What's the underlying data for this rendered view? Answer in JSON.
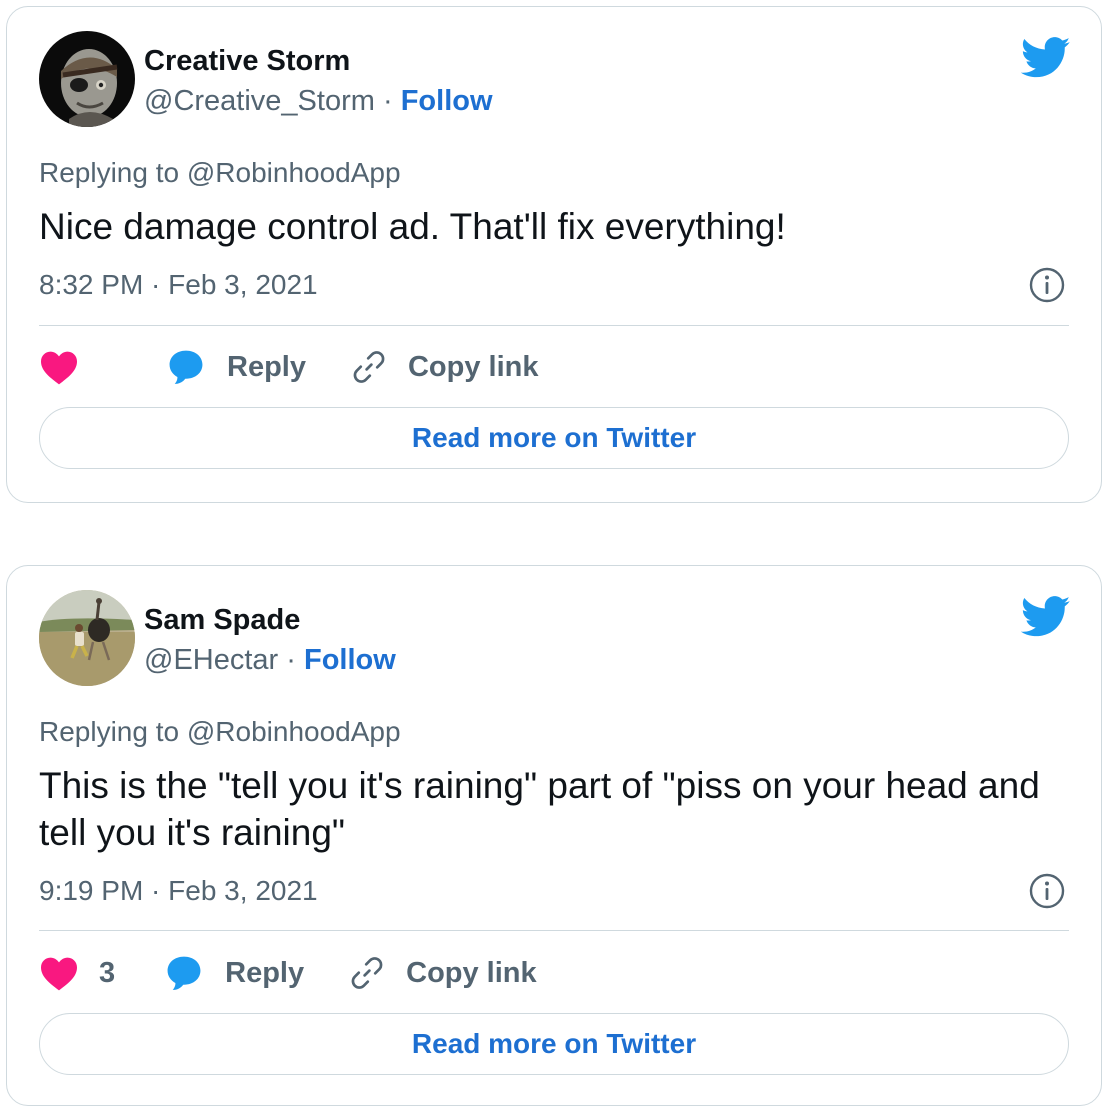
{
  "brand": {
    "twitter_blue": "#1d9bf0",
    "link_blue": "#1d6fd1",
    "like_pink": "#f91880"
  },
  "tweets": [
    {
      "author_name": "Creative Storm",
      "author_handle": "@Creative_Storm",
      "separator": "·",
      "follow_label": "Follow",
      "replying_to": "Replying to @RobinhoodApp",
      "text": "Nice damage control ad. That'll fix everything!",
      "timestamp": "8:32 PM · Feb 3, 2021",
      "like_count": "",
      "reply_label": "Reply",
      "copy_link_label": "Copy link",
      "read_more_label": "Read more on Twitter",
      "icons": {
        "avatar": "avatar-eyepatch-man",
        "logo": "twitter-bird-icon",
        "info": "info-icon",
        "like": "heart-icon",
        "reply": "speech-bubble-icon",
        "copy": "link-icon"
      }
    },
    {
      "author_name": "Sam Spade",
      "author_handle": "@EHectar",
      "separator": "·",
      "follow_label": "Follow",
      "replying_to": "Replying to @RobinhoodApp",
      "text": "This is the \"tell you it's raining\" part of \"piss on your head and tell you it's raining\"",
      "timestamp": "9:19 PM · Feb 3, 2021",
      "like_count": "3",
      "reply_label": "Reply",
      "copy_link_label": "Copy link",
      "read_more_label": "Read more on Twitter",
      "icons": {
        "avatar": "avatar-man-chasing-ostrich",
        "logo": "twitter-bird-icon",
        "info": "info-icon",
        "like": "heart-icon",
        "reply": "speech-bubble-icon",
        "copy": "link-icon"
      }
    }
  ]
}
